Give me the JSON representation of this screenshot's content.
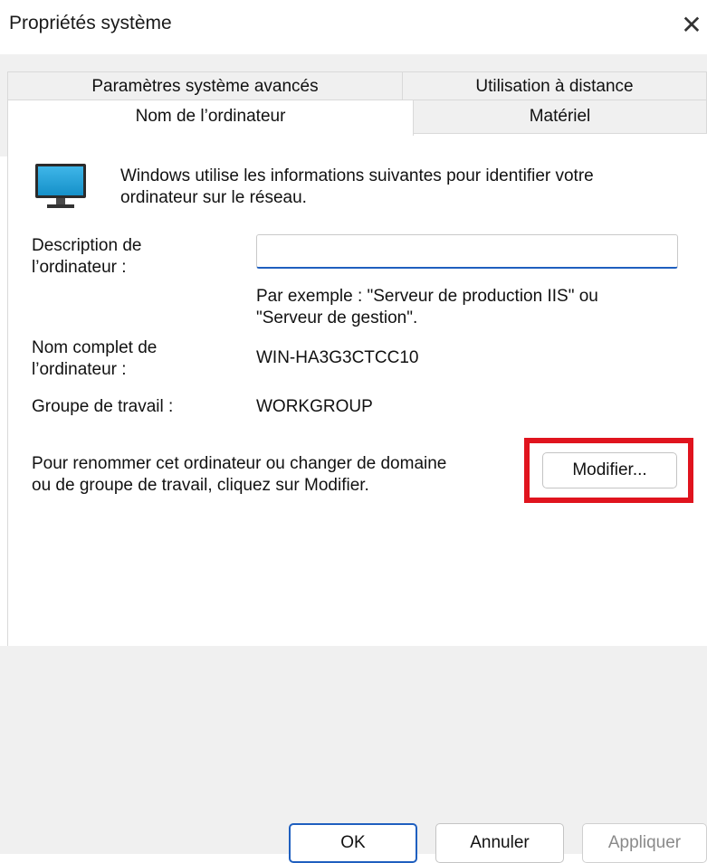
{
  "window": {
    "title": "Propriétés système",
    "close_glyph": "✕"
  },
  "tabs": [
    {
      "label": "Paramètres système avancés",
      "selected": false
    },
    {
      "label": "Utilisation à distance",
      "selected": false
    },
    {
      "label": "Nom de l’ordinateur",
      "selected": true
    },
    {
      "label": "Matériel",
      "selected": false
    }
  ],
  "info": {
    "text_line1": "Windows utilise les informations suivantes pour identifier votre",
    "text_line2": "ordinateur sur le réseau."
  },
  "description": {
    "label_line1": "Description de",
    "label_line2": "l’ordinateur :",
    "value": "",
    "hint_line1": "Par exemple : \"Serveur de production IIS\" ou",
    "hint_line2": "\"Serveur de gestion\"."
  },
  "full_name": {
    "label_line1": "Nom complet de",
    "label_line2": "l’ordinateur :",
    "value": "WIN-HA3G3CTCC10"
  },
  "workgroup": {
    "label": "Groupe de travail :",
    "value": "WORKGROUP"
  },
  "rename": {
    "text_line1": "Pour renommer cet ordinateur ou changer de domaine",
    "text_line2": "ou de groupe de travail, cliquez sur Modifier.",
    "button_label": "Modifier..."
  },
  "footer": {
    "ok_label": "OK",
    "cancel_label": "Annuler",
    "apply_label": "Appliquer"
  },
  "colors": {
    "highlight": "#e0141e",
    "focus_blue": "#1f5fbf",
    "tab_background": "#f0f0f0"
  },
  "icons": {
    "computer": "computer-monitor-icon",
    "close": "close-icon"
  }
}
